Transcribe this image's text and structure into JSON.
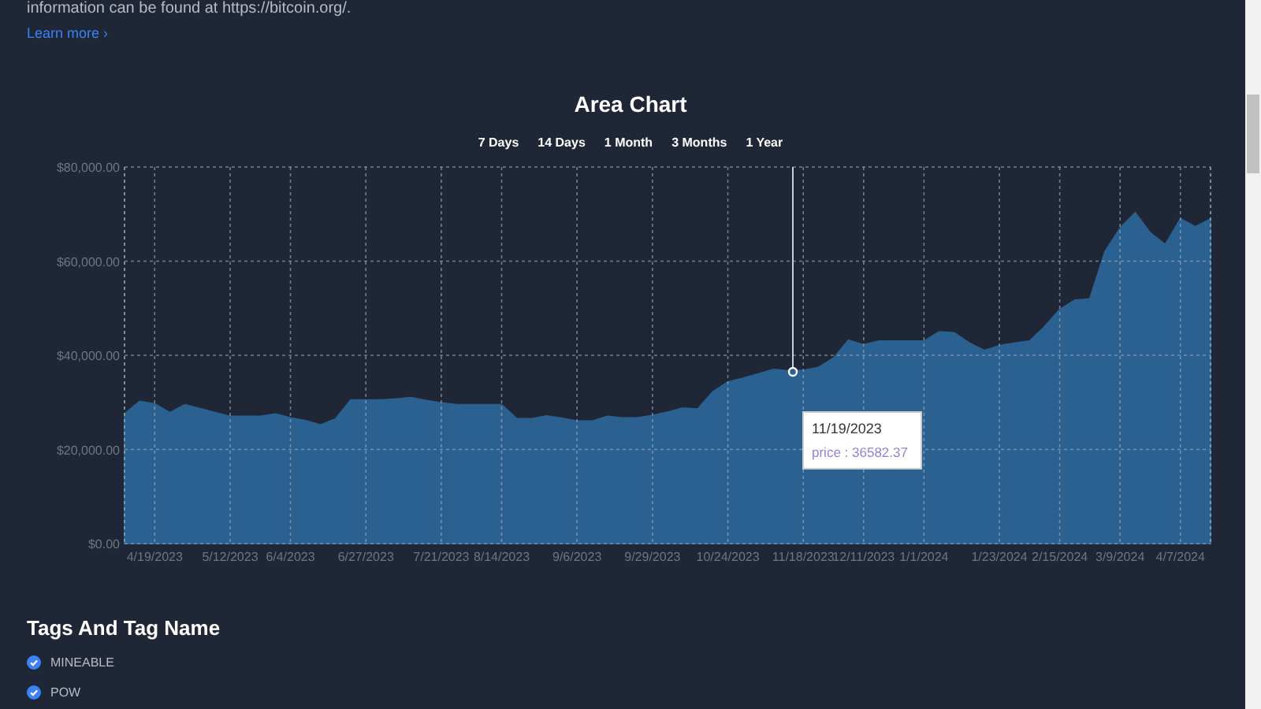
{
  "intro": {
    "text": "information can be found at https://bitcoin.org/.",
    "link": "Learn more",
    "link_icon": "›"
  },
  "chart": {
    "title": "Area Chart",
    "ranges": [
      "7 Days",
      "14 Days",
      "1 Month",
      "3 Months",
      "1 Year"
    ],
    "tooltip": {
      "date": "11/19/2023",
      "label": "price : 36582.37"
    },
    "chart_data": {
      "type": "area",
      "grid": true,
      "ylim": [
        0,
        80000
      ],
      "categories": [
        null,
        null,
        "4/19/2023",
        null,
        null,
        null,
        null,
        "5/12/2023",
        null,
        null,
        null,
        "6/4/2023",
        null,
        null,
        null,
        null,
        "6/27/2023",
        null,
        null,
        null,
        null,
        "7/21/2023",
        null,
        null,
        null,
        "8/14/2023",
        null,
        null,
        null,
        null,
        "9/6/2023",
        null,
        null,
        null,
        null,
        "9/29/2023",
        null,
        null,
        null,
        null,
        "10/24/2023",
        null,
        null,
        null,
        null,
        "11/18/2023",
        null,
        null,
        null,
        "12/11/2023",
        null,
        null,
        null,
        "1/1/2024",
        null,
        null,
        null,
        null,
        "1/23/2024",
        null,
        null,
        null,
        "2/15/2024",
        null,
        null,
        null,
        "3/9/2024",
        null,
        null,
        null,
        "4/7/2024",
        null,
        null
      ],
      "series": [
        {
          "color": "#2b6190",
          "values": [
            27500,
            30200,
            29700,
            27800,
            29500,
            28700,
            27800,
            27000,
            27000,
            27000,
            27500,
            26700,
            26100,
            25200,
            26500,
            30500,
            30500,
            30500,
            30700,
            31000,
            30400,
            29900,
            29500,
            29500,
            29500,
            29500,
            26500,
            26500,
            27100,
            26600,
            26000,
            26000,
            27000,
            26700,
            26700,
            27200,
            27900,
            28800,
            28600,
            32200,
            34300,
            35100,
            36000,
            37000,
            36700,
            36800,
            37400,
            39400,
            43200,
            42200,
            43000,
            43000,
            43000,
            43000,
            45000,
            44800,
            42600,
            41000,
            42000,
            42600,
            43000,
            46100,
            49700,
            51700,
            52000,
            62000,
            67000,
            70300,
            66000,
            63500,
            69000,
            67300,
            69000
          ]
        }
      ],
      "yticks": [
        {
          "value": 0,
          "label": "$0.00"
        },
        {
          "value": 20000,
          "label": "$20,000.00"
        },
        {
          "value": 40000,
          "label": "$40,000.00"
        },
        {
          "value": 60000,
          "label": "$60,000.00"
        },
        {
          "value": 80000,
          "label": "$80,000.00"
        }
      ]
    }
  },
  "tags": {
    "title": "Tags And Tag Name",
    "items": [
      {
        "label": "MINEABLE",
        "checked": true
      },
      {
        "label": "POW",
        "checked": true
      }
    ]
  }
}
